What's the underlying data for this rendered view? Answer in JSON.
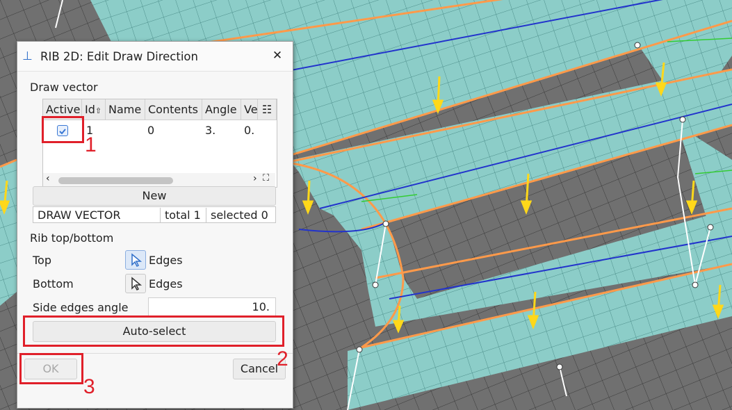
{
  "dialog": {
    "title": "RIB 2D: Edit Draw Direction",
    "close_glyph": "✕",
    "draw_vector_label": "Draw vector",
    "table": {
      "headers": [
        "Active",
        "Id",
        "Name",
        "Contents",
        "Angle",
        "Ve"
      ],
      "row": {
        "active": true,
        "id": "1",
        "name": "",
        "contents": "0",
        "angle": "3.",
        "ve": "0."
      }
    },
    "new_button": "New",
    "status": {
      "name": "DRAW VECTOR",
      "total": "total 1",
      "selected": "selected 0"
    },
    "rib_label": "Rib top/bottom",
    "top_label": "Top",
    "top_edges": "Edges",
    "bottom_label": "Bottom",
    "bottom_edges": "Edges",
    "side_angle_label": "Side edges angle",
    "side_angle_value": "10.",
    "auto_select_button": "Auto-select",
    "ok_button": "OK",
    "cancel_button": "Cancel"
  },
  "annotations": [
    "1",
    "2",
    "3"
  ],
  "colors": {
    "accent": "#3a78d4",
    "annotation_red": "#e0202a",
    "mesh_teal": "#8ccdc8",
    "mesh_gray": "#707070",
    "edge_orange": "#ff9a4a",
    "arrow_yellow": "#ffd81a"
  }
}
